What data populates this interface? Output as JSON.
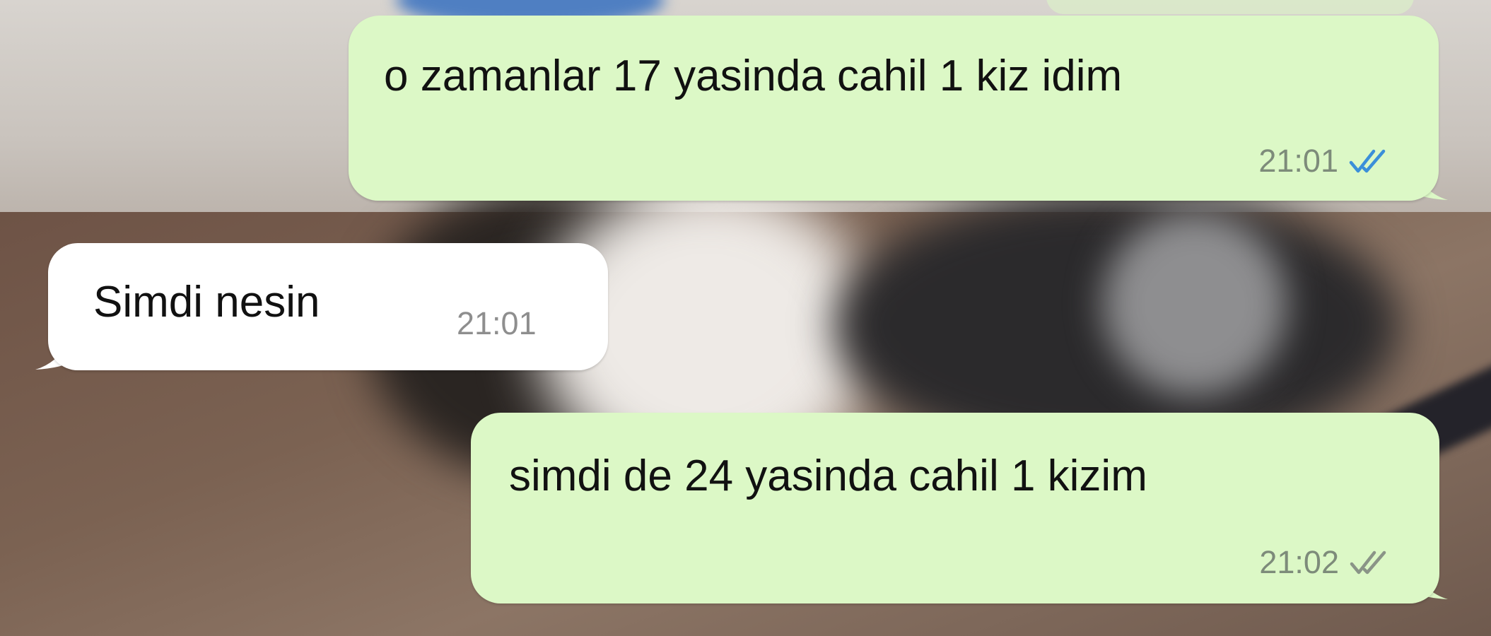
{
  "messages": [
    {
      "direction": "outgoing",
      "text": "o zamanlar 17 yasinda cahil 1 kiz idim",
      "time": "21:01",
      "status_icon": "double-check-read-icon",
      "status_color": "#3b8fd9"
    },
    {
      "direction": "incoming",
      "text": "Simdi nesin",
      "time": "21:01"
    },
    {
      "direction": "outgoing",
      "text": "simdi de 24 yasinda cahil 1 kizim",
      "time": "21:02",
      "status_icon": "double-check-delivered-icon",
      "status_color": "#8a9487"
    }
  ],
  "colors": {
    "outgoing_bubble": "#dcf8c6",
    "incoming_bubble": "#ffffff",
    "message_text": "#111111"
  }
}
